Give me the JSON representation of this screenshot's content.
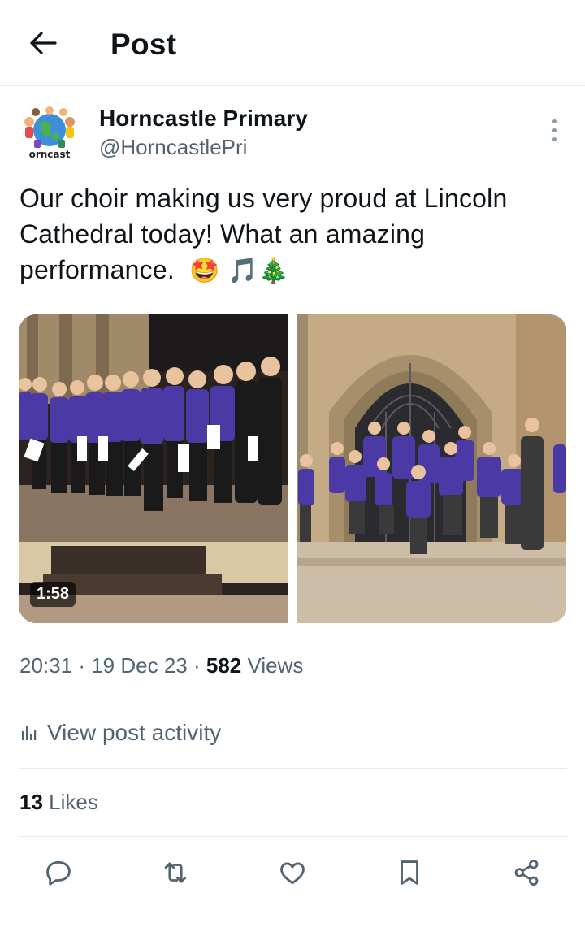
{
  "header": {
    "title": "Post"
  },
  "author": {
    "name": "Horncastle Primary",
    "handle": "@HorncastlePri",
    "avatar_text": "orncast"
  },
  "post": {
    "text_line1": "Our choir making us very proud at Lincoln",
    "text_line2": "Cathedral today! What an amazing",
    "text_line3": "performance.",
    "emojis": "🤩 🎵🎄"
  },
  "media": {
    "video_duration": "1:58"
  },
  "meta": {
    "time": "20:31",
    "separator": "·",
    "date": "19 Dec 23",
    "views_count": "582",
    "views_label": "Views"
  },
  "activity": {
    "label": "View post activity"
  },
  "likes": {
    "count": "13",
    "label": "Likes"
  },
  "actions": {
    "reply": "reply-icon",
    "repost": "repost-icon",
    "like": "heart-icon",
    "bookmark": "bookmark-icon",
    "share": "share-icon"
  },
  "colors": {
    "text_primary": "#0f1419",
    "text_secondary": "#536471",
    "divider": "#e6e9ec",
    "uniform_purple": "#4b3aa6"
  }
}
